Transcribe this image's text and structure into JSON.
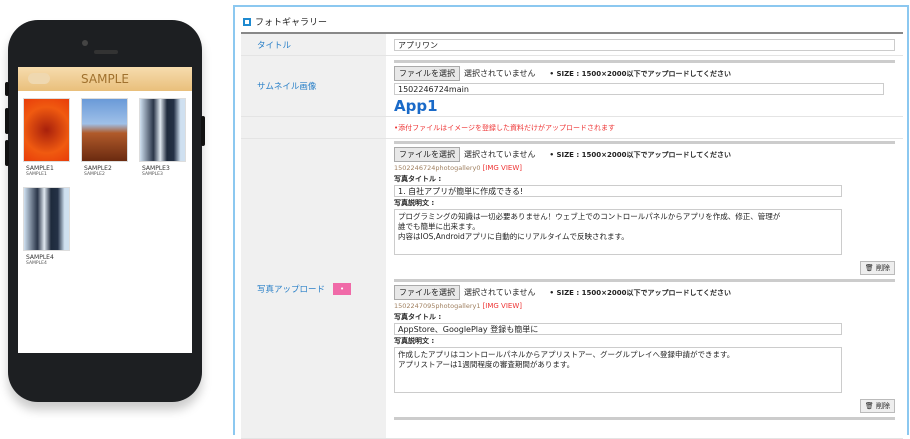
{
  "phone": {
    "header_title": "SAMPLE",
    "items": [
      {
        "title": "SAMPLE1",
        "subtitle": "SAMPLE1"
      },
      {
        "title": "SAMPLE2",
        "subtitle": "SAMPLE2"
      },
      {
        "title": "SAMPLE3",
        "subtitle": "SAMPLE3"
      },
      {
        "title": "SAMPLE4",
        "subtitle": "SAMPLE4"
      }
    ]
  },
  "panel": {
    "title": "フォトギャラリー",
    "title_label": "タイトル",
    "title_value": "アプリワン",
    "thumb_label": "サムネイル画像",
    "file_button": "ファイルを選択",
    "no_file": "選択されていません",
    "size_note": "• SIZE : 1500×2000以下でアップロードしてください",
    "thumb_filename": "1502246724main",
    "thumb_logo": "App1",
    "notice": "•添付ファイルはイメージを登録した資料だけがアップロードされます",
    "upload_label": "写真アップロード",
    "upload_badge": "•",
    "photo_title_label": "写真タイトル :",
    "photo_desc_label": "写真説明文 :",
    "img_view": "[IMG VIEW]",
    "delete": "削除",
    "photos": [
      {
        "filename": "1502246724photogallery0",
        "title": "1. 自社アプリが簡単に作成できる!",
        "desc": "プログラミングの知識は一切必要ありません！ウェブ上でのコントロールパネルからアプリを作成、修正、管理が\n誰でも簡単に出来ます。\n内容はIOS,Androidアプリに自動的にリアルタイムで反映されます。"
      },
      {
        "filename": "1502247095photogallery1",
        "title": "AppStore、GooglePlay 登録も簡単に",
        "desc": "作成したアプリはコントロールパネルからアプリストアー、グーグルプレイへ登録申請ができます。\nアプリストアーは1週間程度の審査期間があります。"
      }
    ]
  }
}
